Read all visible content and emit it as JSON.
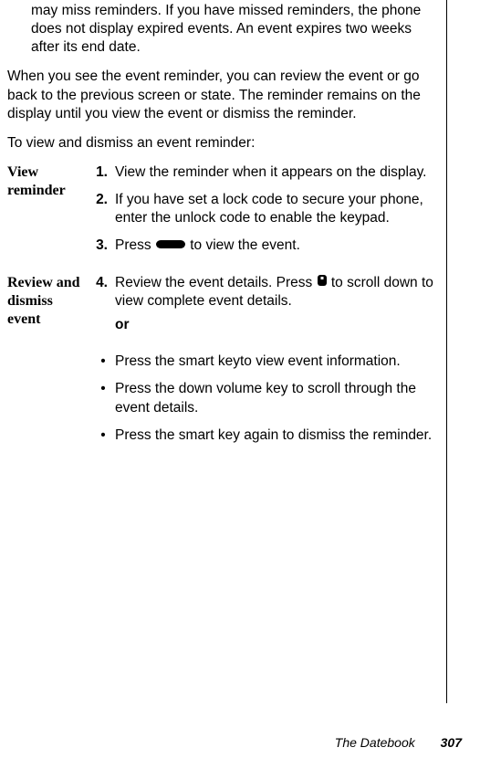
{
  "intro_note": "may miss reminders. If you have missed reminders, the phone does not display expired events. An event expires two weeks after its end date.",
  "para_reminder": "When you see the event reminder, you can review the event or go back to the previous screen or state. The reminder remains on the display until you view the event or dismiss the reminder.",
  "para_lead": "To view and dismiss an event reminder:",
  "sections": {
    "view": {
      "label": "View reminder",
      "steps": {
        "s1": {
          "num": "1.",
          "text": "View the reminder when it appears on the display."
        },
        "s2": {
          "num": "2.",
          "text": "If you have set a lock code to secure your phone, enter the unlock code to enable the keypad."
        },
        "s3": {
          "num": "3.",
          "pre": "Press ",
          "post": " to view the event."
        }
      }
    },
    "review": {
      "label": "Review and dismiss event",
      "steps": {
        "s4": {
          "num": "4.",
          "pre": "Review the event details. Press ",
          "post": " to scroll down to view complete event details."
        },
        "or": "or",
        "b1": "Press the smart keyto view event information.",
        "b2": "Press the down volume key to scroll through the event details.",
        "b3": "Press the smart key again to dismiss the reminder."
      }
    }
  },
  "footer": {
    "title": "The Datebook",
    "page": "307"
  },
  "icons": {
    "longkey": "long-key-icon",
    "scroll": "scroll-key-icon"
  }
}
